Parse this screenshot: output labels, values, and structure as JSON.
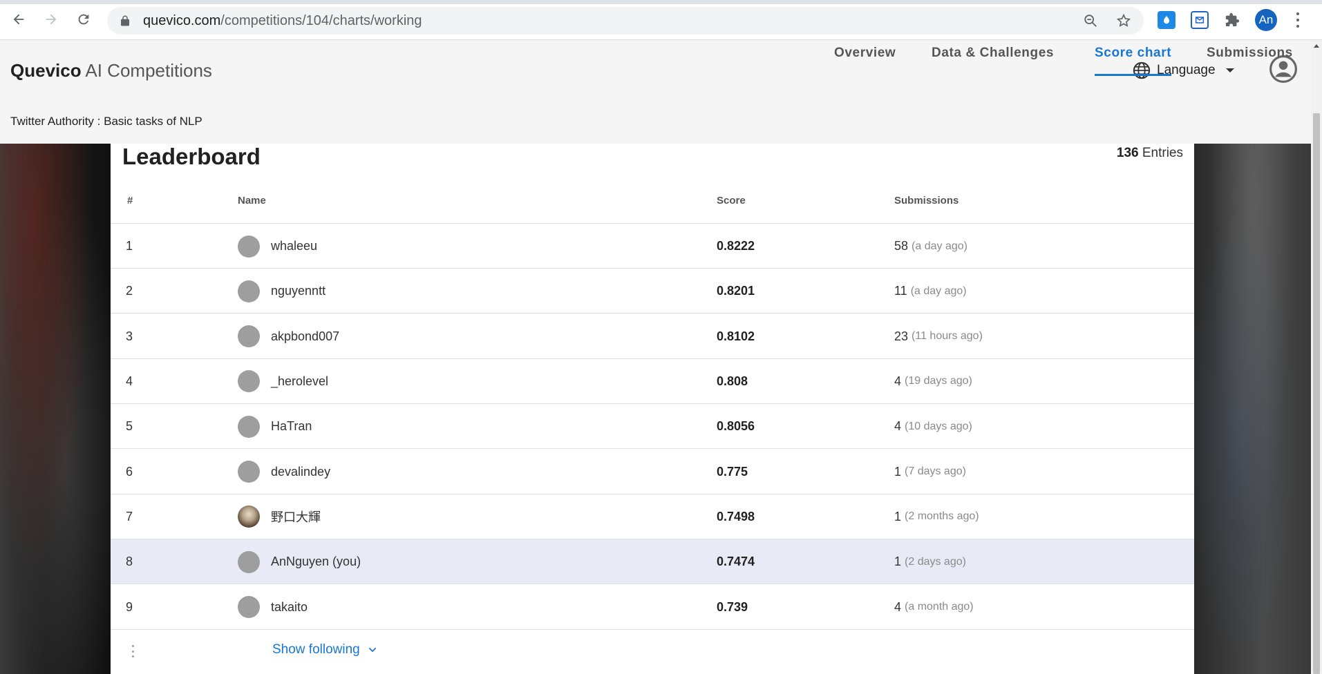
{
  "browser": {
    "url_host": "quevico.com",
    "url_path": "/competitions/104/charts/working",
    "profile_initials": "An"
  },
  "header": {
    "brand_bold": "Quevico",
    "brand_light": "AI Competitions",
    "language_label": "Language",
    "competition_title": "Twitter Authority : Basic tasks of NLP",
    "tabs": [
      {
        "label": "Overview",
        "active": false
      },
      {
        "label": "Data & Challenges",
        "active": false
      },
      {
        "label": "Score chart",
        "active": true
      },
      {
        "label": "Submissions",
        "active": false
      }
    ]
  },
  "leaderboard": {
    "title": "Leaderboard",
    "entries_count": "136",
    "entries_label": "Entries",
    "columns": {
      "rank": "#",
      "name": "Name",
      "score": "Score",
      "submissions": "Submissions"
    },
    "rows": [
      {
        "rank": "1",
        "name": "whaleeu",
        "score": "0.8222",
        "subs": "58",
        "ago": "(a day ago)",
        "avatar": "default",
        "is_you": false
      },
      {
        "rank": "2",
        "name": "nguyenntt",
        "score": "0.8201",
        "subs": "11",
        "ago": "(a day ago)",
        "avatar": "default",
        "is_you": false
      },
      {
        "rank": "3",
        "name": "akpbond007",
        "score": "0.8102",
        "subs": "23",
        "ago": "(11 hours ago)",
        "avatar": "default",
        "is_you": false
      },
      {
        "rank": "4",
        "name": "_herolevel",
        "score": "0.808",
        "subs": "4",
        "ago": "(19 days ago)",
        "avatar": "default",
        "is_you": false
      },
      {
        "rank": "5",
        "name": "HaTran",
        "score": "0.8056",
        "subs": "4",
        "ago": "(10 days ago)",
        "avatar": "default",
        "is_you": false
      },
      {
        "rank": "6",
        "name": "devalindey",
        "score": "0.775",
        "subs": "1",
        "ago": "(7 days ago)",
        "avatar": "default",
        "is_you": false
      },
      {
        "rank": "7",
        "name": "野口大輝",
        "score": "0.7498",
        "subs": "1",
        "ago": "(2 months ago)",
        "avatar": "photo",
        "is_you": false
      },
      {
        "rank": "8",
        "name": "AnNguyen (you)",
        "score": "0.7474",
        "subs": "1",
        "ago": "(2 days ago)",
        "avatar": "default",
        "is_you": true
      },
      {
        "rank": "9",
        "name": "takaito",
        "score": "0.739",
        "subs": "4",
        "ago": "(a month ago)",
        "avatar": "default",
        "is_you": false
      }
    ],
    "show_following_label": "Show following"
  },
  "colors": {
    "accent": "#1976d2",
    "highlight_row": "#e8eaf6",
    "avatar_default": "#9e9e9e",
    "profile_avatar": "#1565c0"
  }
}
